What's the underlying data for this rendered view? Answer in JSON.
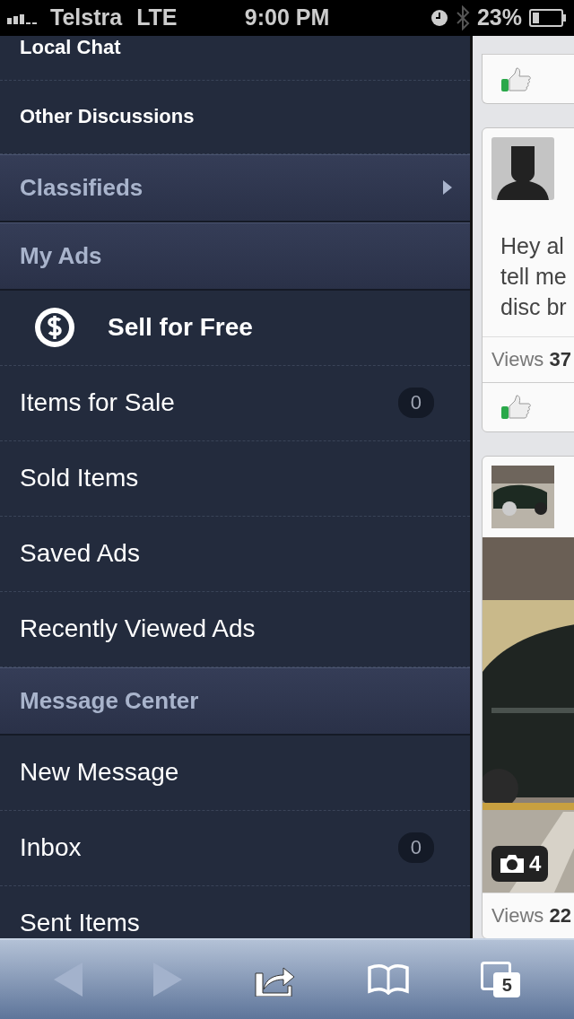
{
  "status_bar": {
    "carrier": "Telstra",
    "network": "LTE",
    "time": "9:00 PM",
    "battery": "23%"
  },
  "menu": [
    {
      "kind": "link",
      "label": "Local Chat"
    },
    {
      "kind": "link",
      "label": "Other Discussions"
    },
    {
      "kind": "header",
      "label": "Classifieds",
      "submenu": true
    },
    {
      "kind": "header",
      "label": "My Ads",
      "submenu": false
    },
    {
      "kind": "action",
      "label": "Sell for Free"
    },
    {
      "kind": "item",
      "label": "Items for Sale",
      "count": "0"
    },
    {
      "kind": "item",
      "label": "Sold Items"
    },
    {
      "kind": "item",
      "label": "Saved Ads"
    },
    {
      "kind": "item",
      "label": "Recently Viewed Ads"
    },
    {
      "kind": "header",
      "label": "Message Center",
      "submenu": false
    },
    {
      "kind": "item",
      "label": "New Message"
    },
    {
      "kind": "item",
      "label": "Inbox",
      "count": "0"
    },
    {
      "kind": "item",
      "label": "Sent Items"
    }
  ],
  "feed": [
    {
      "kind": "cut"
    },
    {
      "kind": "text",
      "text_lines": [
        "Hey al",
        "tell me",
        "disc br"
      ],
      "views_label": "Views",
      "views": "37"
    },
    {
      "photo_count": "4",
      "views_label": "Views",
      "views": "22"
    }
  ],
  "toolbar": {
    "tabs_count": "5"
  }
}
